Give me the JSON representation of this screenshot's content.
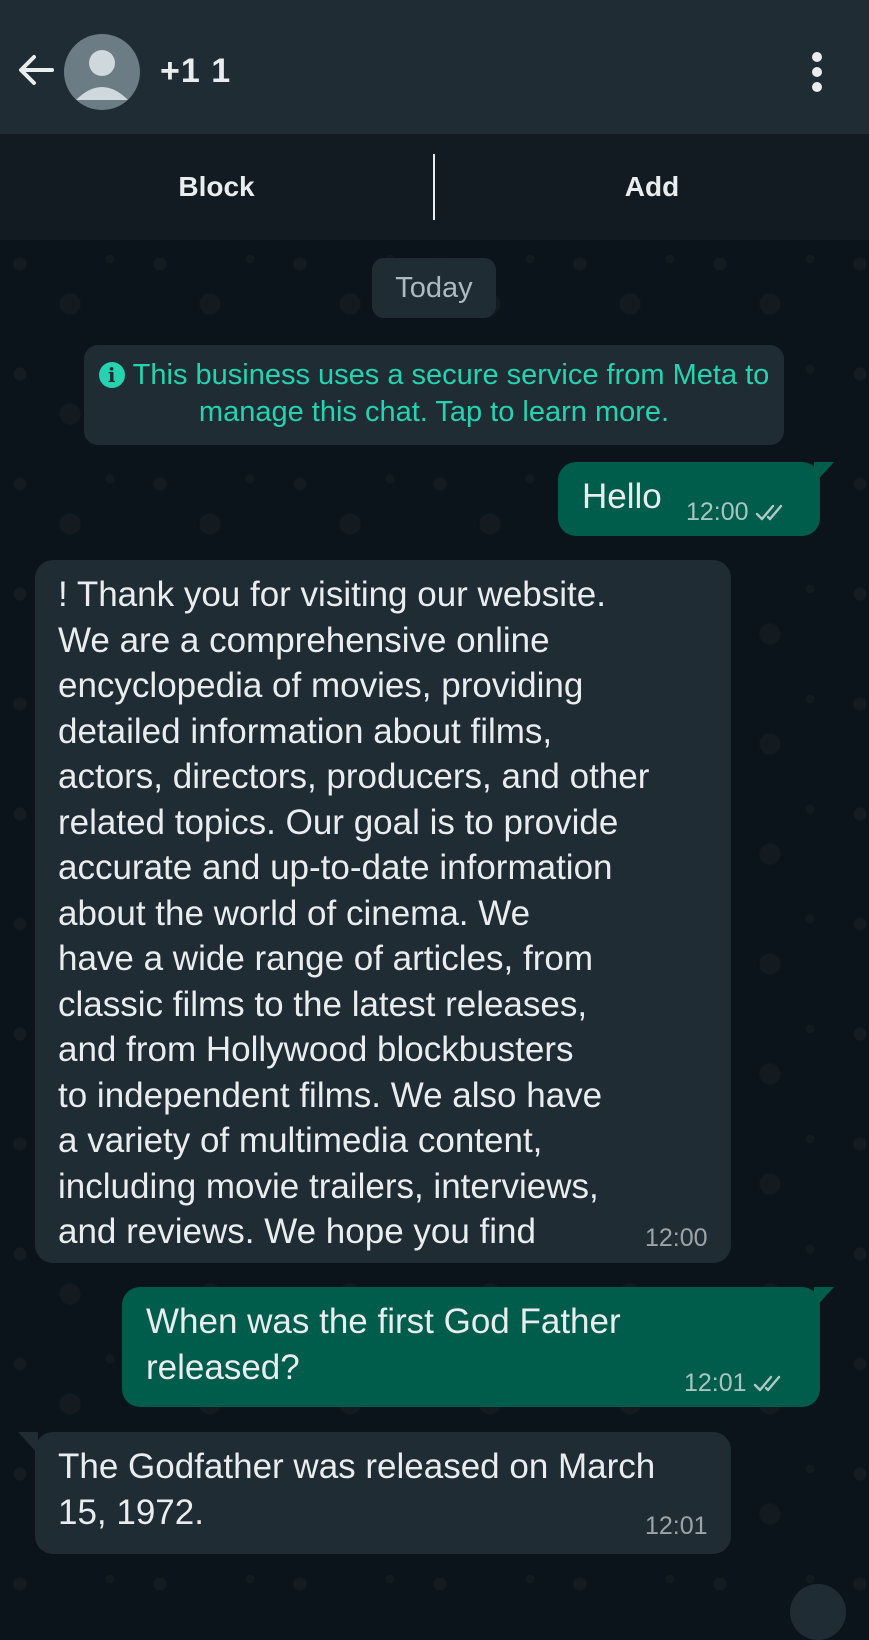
{
  "header": {
    "contact_name": "+1 1",
    "back_icon": "arrow-left-icon",
    "menu_icon": "more-vertical-icon"
  },
  "actions": {
    "block_label": "Block",
    "add_label": "Add"
  },
  "date_chip": "Today",
  "notice": {
    "icon": "info-icon",
    "icon_glyph": "i",
    "text": "This business uses a secure service from Meta to manage this chat. Tap to learn more."
  },
  "messages": [
    {
      "direction": "outgoing",
      "text": "Hello",
      "time": "12:00",
      "status": "read-double-check"
    },
    {
      "direction": "incoming",
      "text": "! Thank you for visiting our website.\nWe are a comprehensive online\nencyclopedia of movies, providing\ndetailed information about films,\nactors, directors, producers, and other\nrelated topics. Our goal is to provide\naccurate and up-to-date information\nabout the world of cinema. We\nhave a wide range of articles, from\nclassic films to the latest releases,\nand from Hollywood blockbusters\nto independent films. We also have\na variety of multimedia content,\nincluding movie trailers, interviews,\nand reviews. We hope you find",
      "time": "12:00"
    },
    {
      "direction": "outgoing",
      "text": "When was the first God Father\nreleased?",
      "time": "12:01",
      "status": "read-double-check"
    },
    {
      "direction": "incoming",
      "text": "The Godfather was released on March\n15, 1972.",
      "time": "12:01"
    }
  ],
  "colors": {
    "header_bg": "#202c33",
    "chat_bg": "#0b141a",
    "outgoing_bubble": "#005c4b",
    "incoming_bubble": "#202c33",
    "notice_text": "#25d3b0"
  }
}
